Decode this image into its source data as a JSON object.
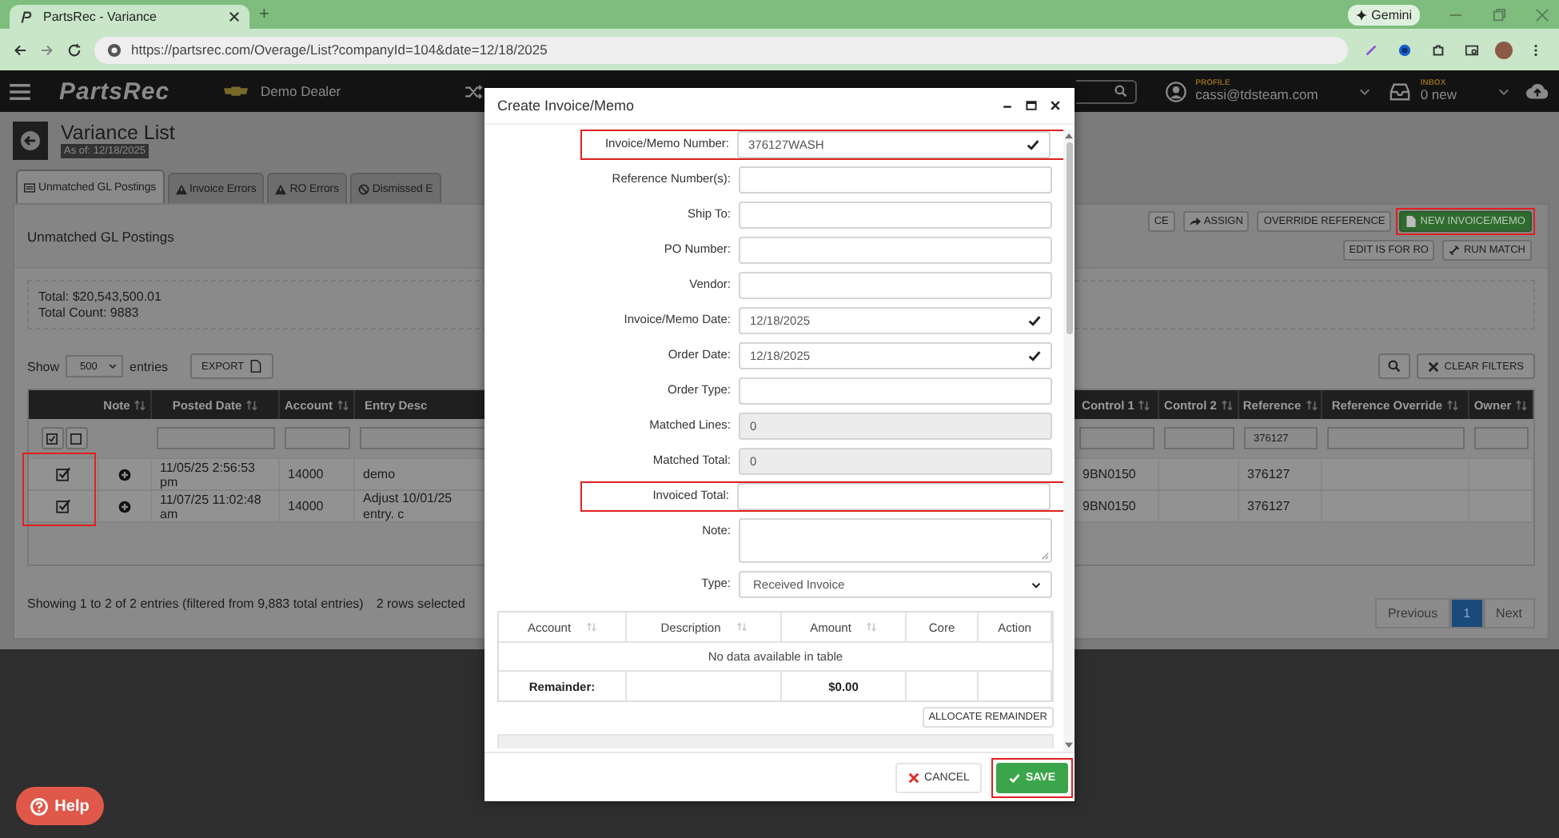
{
  "browser": {
    "tab_title": "PartsRec - Variance",
    "new_tab": "+",
    "url": "https://partsrec.com/Overage/List?companyId=104&date=12/18/2025",
    "gemini": "Gemini"
  },
  "navbar": {
    "logo": "PartsRec",
    "dealer": "Demo Dealer",
    "profile_label": "PROFILE",
    "profile_email": "cassi@tdsteam.com",
    "inbox_label": "INBOX",
    "inbox_count": "0 new"
  },
  "page": {
    "title": "Variance List",
    "as_of": "As of: 12/18/2025"
  },
  "tabs": [
    {
      "label": "Unmatched GL Postings",
      "kind": "list",
      "selected": true
    },
    {
      "label": "Invoice Errors",
      "kind": "warning",
      "selected": false
    },
    {
      "label": "RO Errors",
      "kind": "warning",
      "selected": false
    },
    {
      "label": "Dismissed E",
      "kind": "ban",
      "selected": false
    }
  ],
  "panel": {
    "title": "Unmatched GL Postings",
    "toolbar": [
      {
        "label": "CE",
        "kind": "plain",
        "highlighted": false
      },
      {
        "label": "ASSIGN",
        "kind": "share",
        "highlighted": false
      },
      {
        "label": "OVERRIDE REFERENCE",
        "kind": "plain",
        "highlighted": false
      },
      {
        "label": "NEW INVOICE/MEMO",
        "kind": "new",
        "highlighted": true
      },
      {
        "label": "EDIT IS FOR RO",
        "kind": "plain",
        "highlighted": false
      },
      {
        "label": "RUN MATCH",
        "kind": "link",
        "highlighted": false
      }
    ],
    "total": "Total: $20,543,500.01",
    "count": "Total Count: 9883",
    "show_label": "Show",
    "page_length": "500",
    "entries_label": "entries",
    "export": "EXPORT",
    "clear_filters": "CLEAR FILTERS",
    "table": {
      "checkbox_column_highlighted": true,
      "columns": [
        {
          "label": "Note",
          "kind": "icon",
          "sortable": true,
          "filter": false
        },
        {
          "label": "Posted Date",
          "kind": "text",
          "sortable": true,
          "filter": true
        },
        {
          "label": "Account",
          "kind": "text",
          "sortable": true,
          "filter": true
        },
        {
          "label": "Entry Desc",
          "kind": "text",
          "sortable": false,
          "filter": true
        },
        {
          "label": "Control 1",
          "kind": "text",
          "sortable": true,
          "filter": true
        },
        {
          "label": "Control 2",
          "kind": "text",
          "sortable": true,
          "filter": true
        },
        {
          "label": "Reference",
          "kind": "text",
          "sortable": true,
          "filter": true,
          "filter_value": "376127"
        },
        {
          "label": "Reference Override",
          "kind": "text",
          "sortable": true,
          "filter": true
        },
        {
          "label": "Owner",
          "kind": "text",
          "sortable": true,
          "filter": true
        }
      ],
      "rows": [
        {
          "selected": true,
          "posted_date": "11/05/25 2:56:53 pm",
          "account": "14000",
          "entry_desc": "demo",
          "control_1": "9BN0150",
          "reference": "376127"
        },
        {
          "selected": true,
          "posted_date": "11/07/25 11:02:48 am",
          "account": "14000",
          "entry_desc": "Adjust 10/01/25 entry. c",
          "control_1": "9BN0150",
          "reference": "376127"
        }
      ]
    },
    "info": "Showing 1 to 2 of 2 entries (filtered from 9,883 total entries)",
    "selected_info": "2 rows selected",
    "pagination": [
      {
        "label": "Previous",
        "selected": false
      },
      {
        "label": "1",
        "selected": true
      },
      {
        "label": "Next",
        "selected": false
      }
    ]
  },
  "modal": {
    "title": "Create Invoice/Memo",
    "fields": [
      {
        "label": "Invoice/Memo Number:",
        "kind": "text",
        "value": "376127WASH",
        "valid": true,
        "disabled": false,
        "highlighted": true
      },
      {
        "label": "Reference Number(s):",
        "kind": "text",
        "valid": false,
        "disabled": false,
        "highlighted": false
      },
      {
        "label": "Ship To:",
        "kind": "text",
        "valid": false,
        "disabled": false,
        "highlighted": false
      },
      {
        "label": "PO Number:",
        "kind": "text",
        "valid": false,
        "disabled": false,
        "highlighted": false
      },
      {
        "label": "Vendor:",
        "kind": "text",
        "valid": false,
        "disabled": false,
        "highlighted": false
      },
      {
        "label": "Invoice/Memo Date:",
        "kind": "text",
        "value": "12/18/2025",
        "valid": true,
        "disabled": false,
        "highlighted": false
      },
      {
        "label": "Order Date:",
        "kind": "text",
        "value": "12/18/2025",
        "valid": true,
        "disabled": false,
        "highlighted": false
      },
      {
        "label": "Order Type:",
        "kind": "text",
        "valid": false,
        "disabled": false,
        "highlighted": false
      },
      {
        "label": "Matched Lines:",
        "kind": "text",
        "value": "0",
        "valid": false,
        "disabled": true,
        "highlighted": false
      },
      {
        "label": "Matched Total:",
        "kind": "text",
        "value": "0",
        "valid": false,
        "disabled": true,
        "highlighted": false
      },
      {
        "label": "Invoiced Total:",
        "kind": "text",
        "valid": false,
        "disabled": false,
        "highlighted": true
      },
      {
        "label": "Note:",
        "kind": "textarea",
        "valid": false,
        "disabled": false,
        "highlighted": false
      },
      {
        "label": "Type:",
        "kind": "select",
        "value": "Received Invoice",
        "valid": false,
        "disabled": false,
        "highlighted": false
      }
    ],
    "lines_table": {
      "columns": [
        {
          "label": "Account",
          "sortable": true
        },
        {
          "label": "Description",
          "sortable": true
        },
        {
          "label": "Amount",
          "sortable": true
        },
        {
          "label": "Core",
          "sortable": false
        },
        {
          "label": "Action",
          "sortable": false
        }
      ],
      "empty": "No data available in table",
      "footer_label": "Remainder:",
      "footer_amount": "$0.00"
    },
    "allocate": "ALLOCATE REMAINDER",
    "cancel": "CANCEL",
    "save": {
      "label": "SAVE",
      "highlighted": true
    }
  },
  "help": "Help"
}
